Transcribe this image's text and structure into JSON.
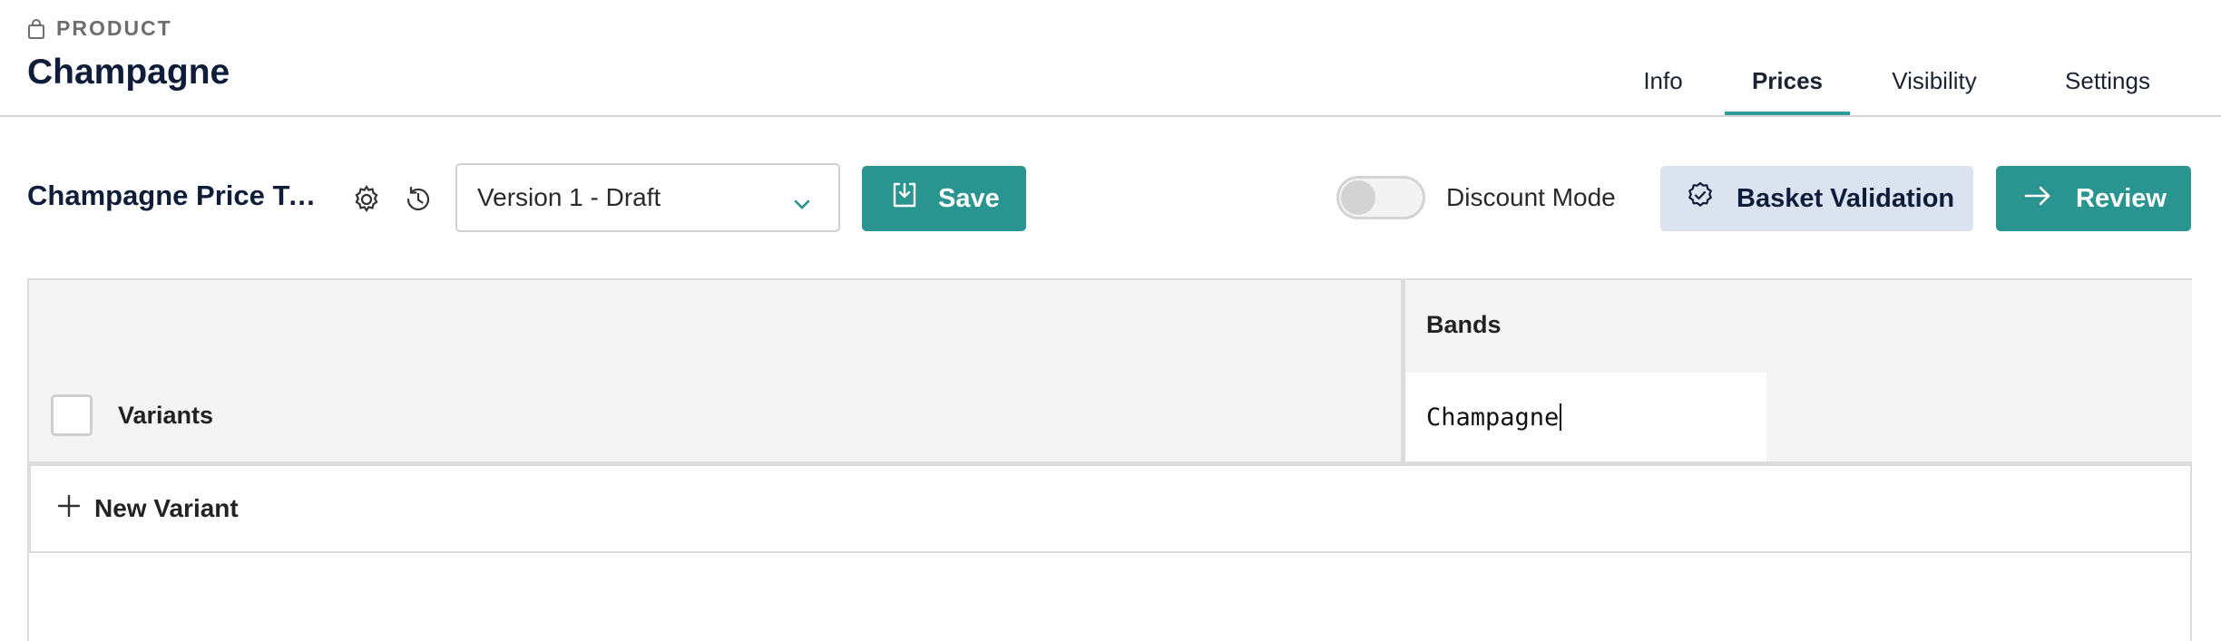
{
  "header": {
    "eyebrow": "PRODUCT",
    "title": "Champagne",
    "tabs": [
      {
        "label": "Info",
        "active": false
      },
      {
        "label": "Prices",
        "active": true
      },
      {
        "label": "Visibility",
        "active": false
      },
      {
        "label": "Settings",
        "active": false
      }
    ]
  },
  "toolbar": {
    "table_name": "Champagne Price Table",
    "version_select": {
      "selected": "Version 1 - Draft"
    },
    "save_label": "Save",
    "discount_mode": {
      "label": "Discount Mode",
      "enabled": false
    },
    "basket_validation_label": "Basket Validation",
    "review_label": "Review"
  },
  "grid": {
    "bands_header": "Bands",
    "variants_label": "Variants",
    "band_cell_value": "Champagne",
    "new_variant_label": "New Variant"
  },
  "colors": {
    "accent": "#2a9490",
    "tab_underline": "#2a9c99",
    "basket_bg": "#dbe3f1",
    "title": "#0f1d3a"
  },
  "icons": {
    "eyebrow": "shopping-bag-icon",
    "settings": "gear-icon",
    "history": "history-icon",
    "dropdown": "chevron-down-icon",
    "save": "save-download-icon",
    "basket": "badge-check-icon",
    "review": "arrow-right-icon",
    "add": "plus-icon"
  }
}
